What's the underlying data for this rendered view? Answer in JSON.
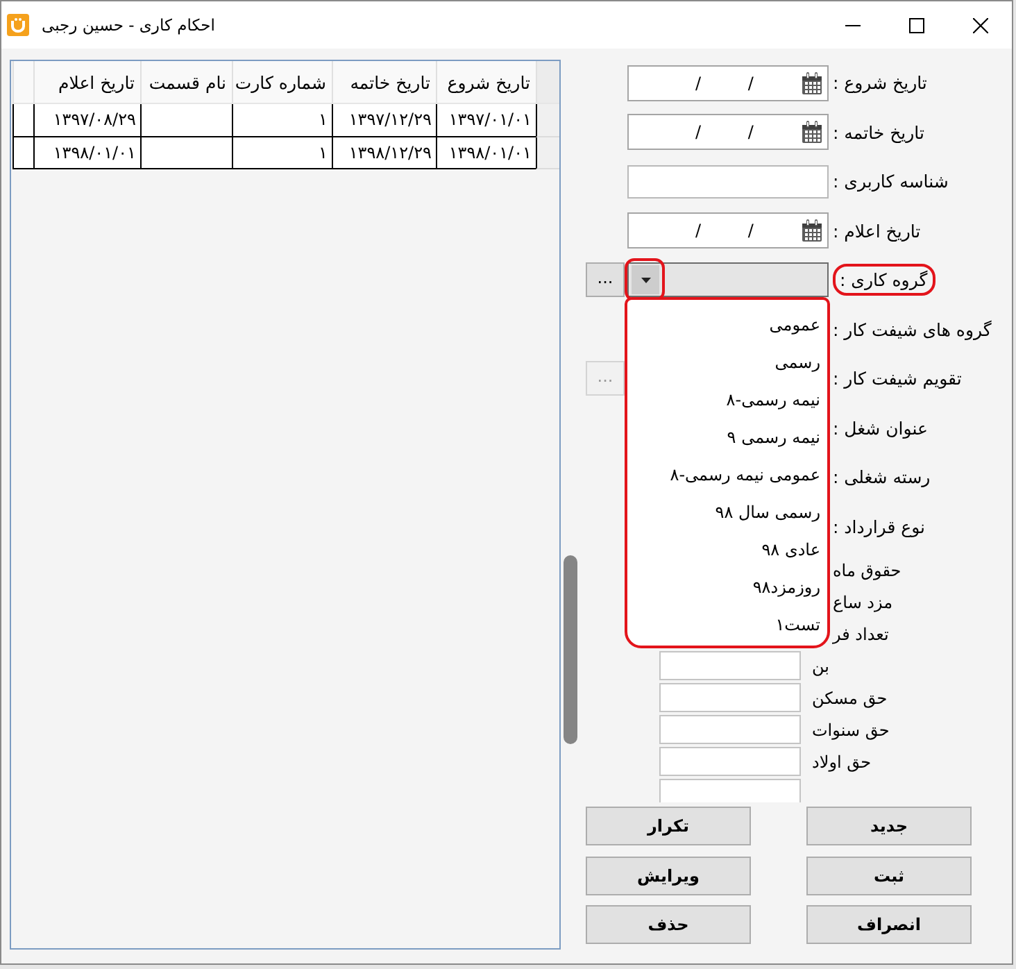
{
  "window": {
    "title": "احکام کاری - حسین رجبی"
  },
  "grid": {
    "columns": [
      "تاریخ شروع",
      "تاریخ خاتمه",
      "شماره کارت",
      "نام قسمت",
      "تاریخ اعلام"
    ],
    "rows": [
      [
        "۱۳۹۷/۰۱/۰۱",
        "۱۳۹۷/۱۲/۲۹",
        "۱",
        null,
        "۱۳۹۷/۰۸/۲۹"
      ],
      [
        "۱۳۹۸/۰۱/۰۱",
        "۱۳۹۸/۱۲/۲۹",
        "۱",
        null,
        "۱۳۹۸/۰۱/۰۱"
      ]
    ]
  },
  "form": {
    "rows": [
      {
        "kind": "date",
        "label": "تاریخ شروع :",
        "value": "/ /"
      },
      {
        "kind": "date",
        "label": "تاریخ خاتمه :",
        "value": "/ /"
      },
      {
        "kind": "text",
        "label": "شناسه کاربری :"
      },
      {
        "kind": "date",
        "label": "تاریخ اعلام :",
        "value": "/ /"
      },
      {
        "kind": "combo",
        "label": "گروه کاری :",
        "highlighted": true,
        "expanded": true,
        "side_button": {
          "label": "...",
          "disabled": false
        },
        "items": [
          {
            "label": "عمومی",
            "selected": false
          },
          {
            "label": "رسمی",
            "selected": false
          },
          {
            "label": "نیمه رسمی-۸",
            "selected": false
          },
          {
            "label": "نیمه رسمی ۹",
            "selected": false
          },
          {
            "label": "عمومی نیمه رسمی-۸",
            "selected": false
          },
          {
            "label": "رسمی سال ۹۸",
            "selected": false
          },
          {
            "label": "عادی ۹۸",
            "selected": false
          },
          {
            "label": "روزمزد۹۸",
            "selected": false
          },
          {
            "label": "تست۱",
            "selected": false
          }
        ]
      },
      {
        "kind": "covered",
        "label": "گروه های شیفت کار :"
      },
      {
        "kind": "covered",
        "label": "تقویم شیفت کار :",
        "side_button": {
          "label": "...",
          "disabled": true
        }
      },
      {
        "kind": "covered",
        "label": "عنوان شغل :"
      },
      {
        "kind": "covered",
        "label": "رسته شغلی :"
      },
      {
        "kind": "covered",
        "label": "نوع قرارداد :"
      }
    ],
    "amounts": [
      {
        "kind": "covered",
        "label": "حقوق ماه"
      },
      {
        "kind": "covered",
        "label": "مزد ساع"
      },
      {
        "kind": "covered",
        "label": "تعداد فر"
      },
      {
        "kind": "entry",
        "label": "بن"
      },
      {
        "kind": "entry",
        "label": "حق مسکن"
      },
      {
        "kind": "entry",
        "label": "حق سنوات"
      },
      {
        "kind": "entry",
        "label": "حق اولاد"
      },
      {
        "kind": "entry"
      }
    ]
  },
  "buttons": [
    "جدید",
    "تکرار",
    "ثبت",
    "ویرایش",
    "انصراف",
    "حذف"
  ]
}
